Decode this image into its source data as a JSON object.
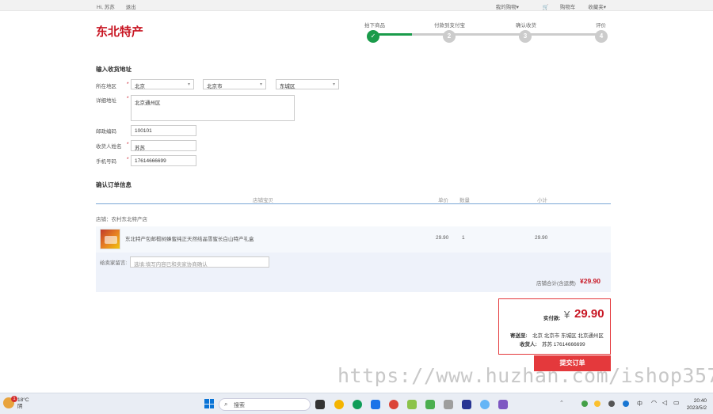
{
  "topbar": {
    "user": "Hi, 苏苏",
    "logout": "退出",
    "my_orders": "我的购物▾",
    "cart": "购物车",
    "favorites": "收藏夹▾"
  },
  "logo": "东北特产",
  "steps": [
    {
      "label": "拍下商品",
      "num": "✓"
    },
    {
      "label": "付款到支付宝",
      "num": "2"
    },
    {
      "label": "确认收货",
      "num": "3"
    },
    {
      "label": "评价",
      "num": "4"
    }
  ],
  "address_section": {
    "title": "输入收货地址",
    "region_label": "所在地区",
    "province": "北京",
    "city": "北京市",
    "district": "东城区",
    "detail_label": "详细地址",
    "detail_value": "北京通州区",
    "zip_label": "邮政编码",
    "zip_value": "100101",
    "name_label": "收货人姓名",
    "name_value": "苏苏",
    "phone_label": "手机号码",
    "phone_value": "17614666699",
    "required_mark": "*"
  },
  "order_section": {
    "title": "确认订单信息",
    "columns": {
      "item": "店铺宝贝",
      "price": "单价",
      "qty": "数量",
      "subtotal": "小计"
    },
    "store": "店铺：农村东北特产店",
    "item_name": "东北特产包邮椴树蜂蜜纯正天然结晶雪蜜长白山特产礼盒",
    "item_price": "29.90",
    "item_qty": "1",
    "item_subtotal": "29.90",
    "message_label": "给卖家留言:",
    "message_placeholder": "选填:填写内容已和卖家协商确认",
    "store_total_label": "店铺合计(含运费)",
    "store_total_value": "¥29.90"
  },
  "summary": {
    "paid_label": "实付款:",
    "currency": "¥",
    "paid_value": "29.90",
    "ship_to_label": "寄送至:",
    "ship_to_value": "北京 北京市 东城区 北京通州区",
    "receiver_label": "收货人:",
    "receiver_value": "苏苏 17614666699"
  },
  "submit_label": "提交订单",
  "watermark": "https://www.huzhan.com/ishop3572",
  "taskbar": {
    "temperature": "18°C",
    "weather": "阴",
    "search": "搜索",
    "ime": "中",
    "time": "20:40",
    "date": "2023/5/2",
    "badge": "1"
  }
}
